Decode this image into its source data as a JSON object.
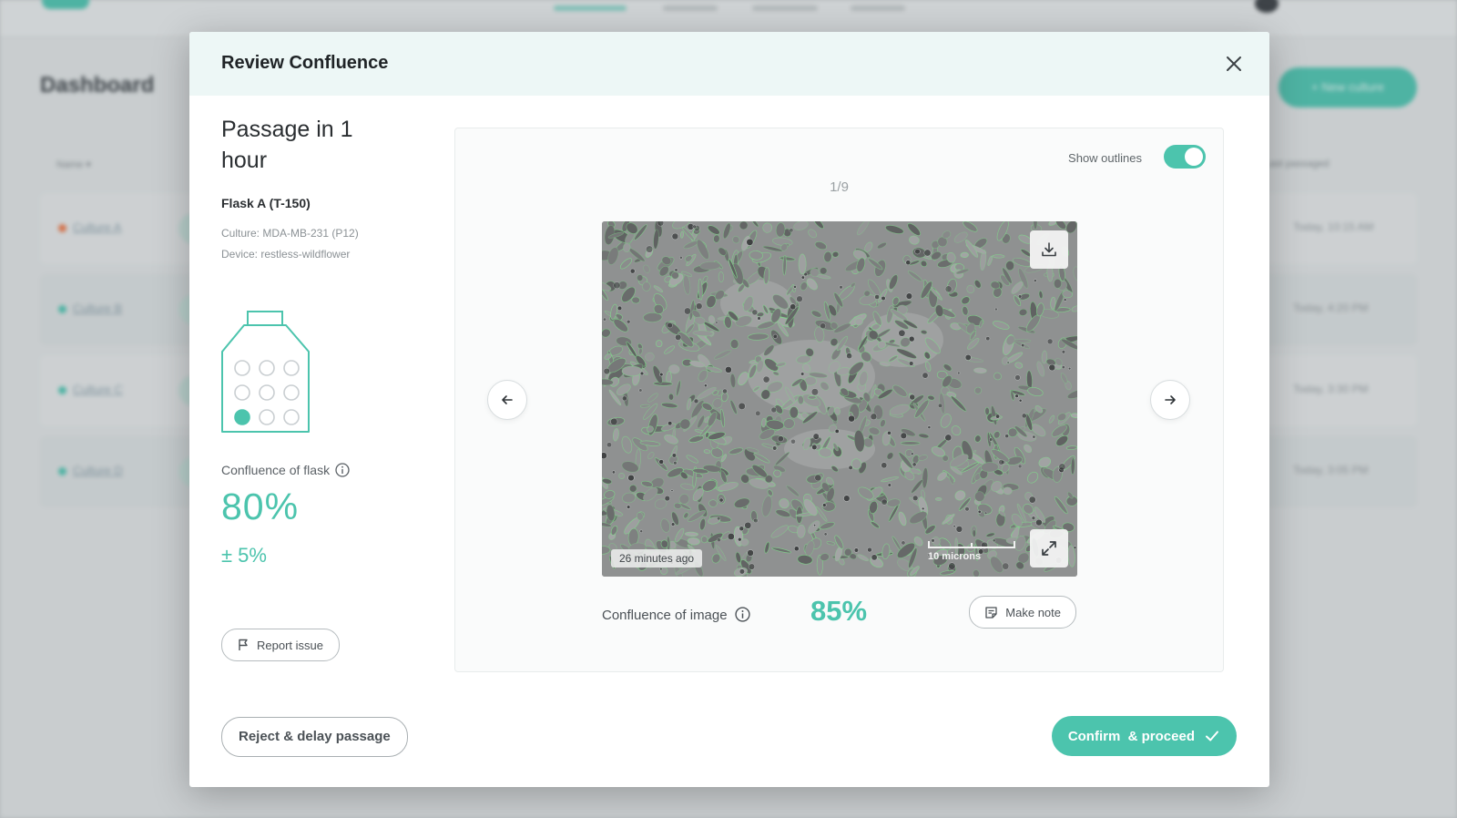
{
  "background": {
    "dashboard_title": "Dashboard",
    "new_button_label": "+ New culture",
    "name_column": "Name ▾",
    "last_column": "Last passaged",
    "rows": [
      {
        "name": "Culture A",
        "status_color": "#f07a4a",
        "time": "Today, 10:15 AM"
      },
      {
        "name": "Culture B",
        "status_color": "#4fc7b3",
        "time": "Today, 4:20 PM"
      },
      {
        "name": "Culture C",
        "status_color": "#4fc7b3",
        "time": "Today, 3:30 PM"
      },
      {
        "name": "Culture D",
        "status_color": "#4fc7b3",
        "time": "Today, 3:05 PM"
      }
    ]
  },
  "modal": {
    "title": "Review Confluence",
    "close_icon": "close-icon",
    "passage_text": "Passage in 1 hour",
    "flask_name": "Flask A (T-150)",
    "culture": "Culture: MDA-MB-231 (P12)",
    "device": "Device: restless-wildflower",
    "flask_grid": {
      "rows": 3,
      "cols": 3,
      "selected_index": 6
    },
    "flask_confluence_label": "Confluence of flask",
    "flask_confluence_value": "80%",
    "flask_confluence_error": "± 5%",
    "report_issue_label": "Report issue",
    "show_outlines_label": "Show outlines",
    "show_outlines_on": true,
    "image_counter": "1/9",
    "image_timestamp": "26 minutes ago",
    "scale_bar_label": "10 microns",
    "image_confluence_label": "Confluence of image",
    "image_confluence_value": "85%",
    "make_note_label": "Make note",
    "reject_label": "Reject & delay passage",
    "confirm_label": "Confirm  & proceed"
  },
  "colors": {
    "accent": "#4cc4ad",
    "outline": "#7fe08a"
  }
}
